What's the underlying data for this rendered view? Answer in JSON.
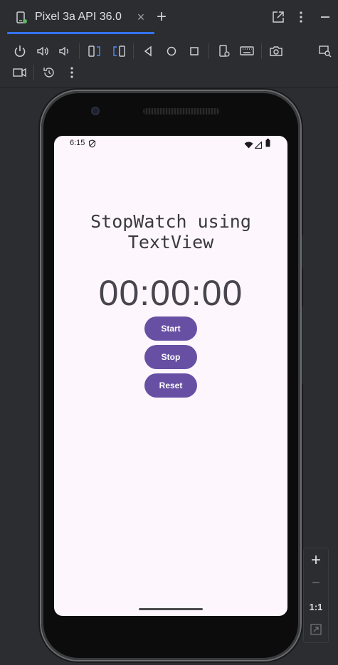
{
  "tab": {
    "title": "Pixel 3a API 36.0",
    "close_glyph": "×",
    "add_glyph": "+"
  },
  "toolbar_icons": [
    "power-icon",
    "volume-up-icon",
    "volume-down-icon",
    "rotate-left-icon",
    "rotate-right-icon",
    "back-icon",
    "home-icon",
    "overview-icon",
    "device-settings-icon",
    "keyboard-icon",
    "screenshot-icon",
    "display-mode-icon",
    "screen-record-icon",
    "snapshot-history-icon",
    "more-options-icon"
  ],
  "status_bar": {
    "time": "6:15"
  },
  "app": {
    "heading_line1": "StopWatch using",
    "heading_line2": "TextView",
    "timer": "00:00:00",
    "start_label": "Start",
    "stop_label": "Stop",
    "reset_label": "Reset",
    "button_color": "#6750a4",
    "background_color": "#fdf7fd"
  },
  "zoom_panel": {
    "zoom_in": "+",
    "zoom_out": "−",
    "actual_size": "1:1"
  },
  "colors": {
    "accent": "#3574f0",
    "ide_background": "#2b2d30"
  }
}
